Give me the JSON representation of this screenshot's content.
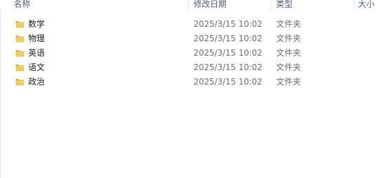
{
  "columns": {
    "name": "名称",
    "modified": "修改日期",
    "type": "类型",
    "size": "大小"
  },
  "files": [
    {
      "name": "数学",
      "modified": "2025/3/15 10:02",
      "type": "文件夹",
      "icon": "folder-icon"
    },
    {
      "name": "物理",
      "modified": "2025/3/15 10:02",
      "type": "文件夹",
      "icon": "folder-icon"
    },
    {
      "name": "英语",
      "modified": "2025/3/15 10:02",
      "type": "文件夹",
      "icon": "folder-icon"
    },
    {
      "name": "语文",
      "modified": "2025/3/15 10:02",
      "type": "文件夹",
      "icon": "folder-icon"
    },
    {
      "name": "政治",
      "modified": "2025/3/15 10:02",
      "type": "文件夹",
      "icon": "folder-icon"
    }
  ],
  "colors": {
    "header_text": "#4c607a",
    "folder_yellow": "#f3c95a",
    "folder_dark": "#d9a431"
  }
}
